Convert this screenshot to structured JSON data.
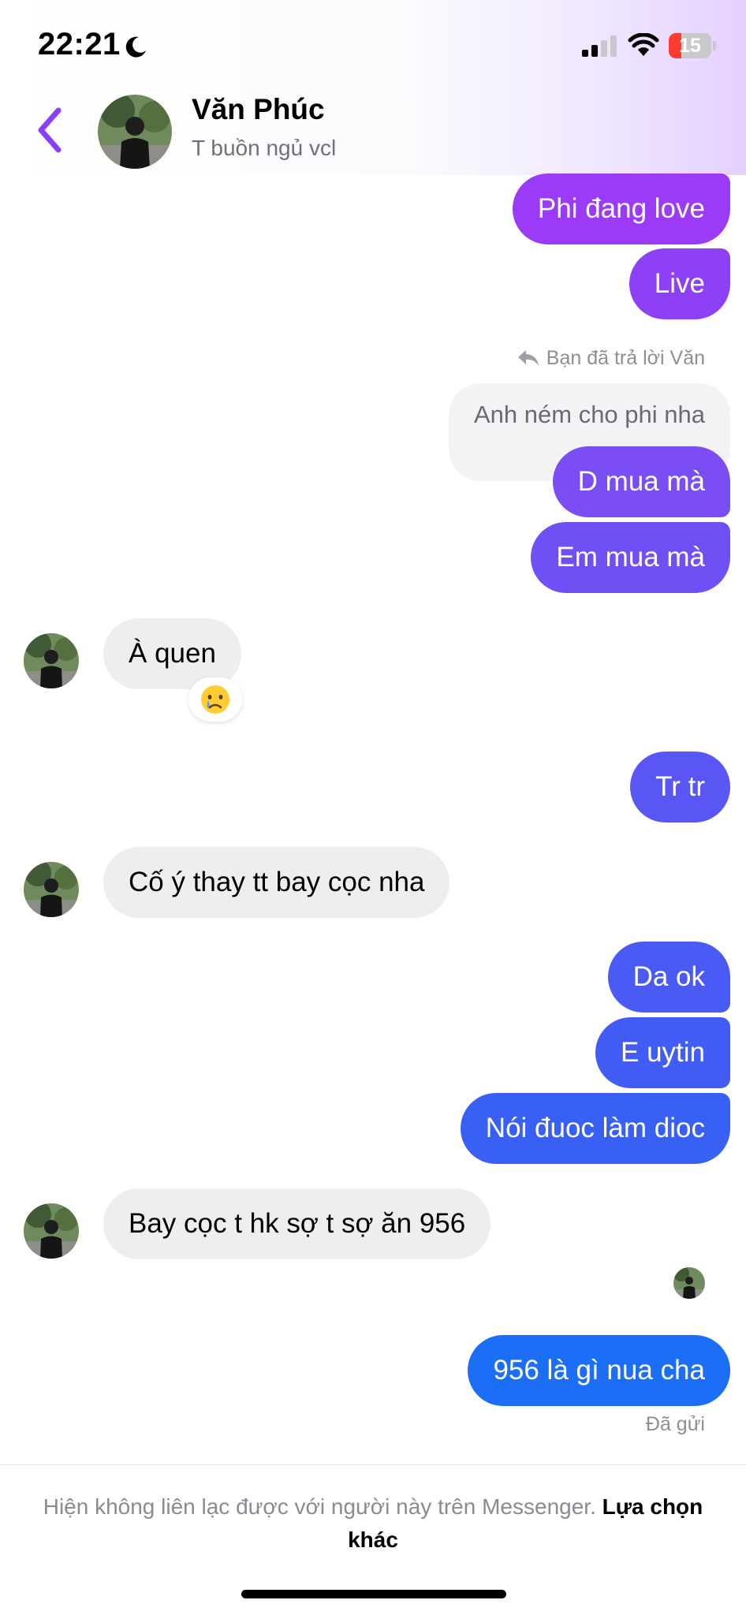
{
  "status_bar": {
    "time": "22:21",
    "battery_level": "15"
  },
  "header": {
    "contact_name": "Văn Phúc",
    "contact_status": "T buồn ngủ vcl"
  },
  "messages": [
    {
      "direction": "out",
      "text": "Phi đang love"
    },
    {
      "direction": "out",
      "text": "Live"
    },
    {
      "direction": "out",
      "reply_label": "Bạn đã trả lời Văn",
      "quoted_text": "Anh ném cho phi nha",
      "text": "D mua mà"
    },
    {
      "direction": "out",
      "text": "Em mua mà"
    },
    {
      "direction": "in",
      "text": "À quen",
      "reaction": "crying-face"
    },
    {
      "direction": "out",
      "text": "Tr tr"
    },
    {
      "direction": "in",
      "text": "Cố ý thay tt bay cọc nha"
    },
    {
      "direction": "out",
      "text": "Da ok"
    },
    {
      "direction": "out",
      "text": "E uytin"
    },
    {
      "direction": "out",
      "text": "Nói đuoc làm dioc"
    },
    {
      "direction": "in",
      "text": "Bay cọc t hk sợ t sợ ăn 956"
    },
    {
      "direction": "out",
      "text": "956 là gì nua cha",
      "status": "Đã gửi"
    }
  ],
  "footer": {
    "notice": "Hiện không liên lạc được với người này trên Messenger.",
    "link": "Lựa chọn khác"
  },
  "colors": {
    "accent": "#8a3ffc",
    "bubble_gradient": [
      "#9b3bf7",
      "#7a4df5",
      "#5a55f5",
      "#2d64f5",
      "#1b6ef5"
    ],
    "incoming_bubble": "#eeeef0",
    "battery_low": "#ff3b30"
  },
  "icons": [
    "moon-icon",
    "signal-icon",
    "wifi-icon",
    "battery-icon",
    "back-chevron-icon",
    "reply-arrow-icon",
    "crying-face-icon"
  ]
}
